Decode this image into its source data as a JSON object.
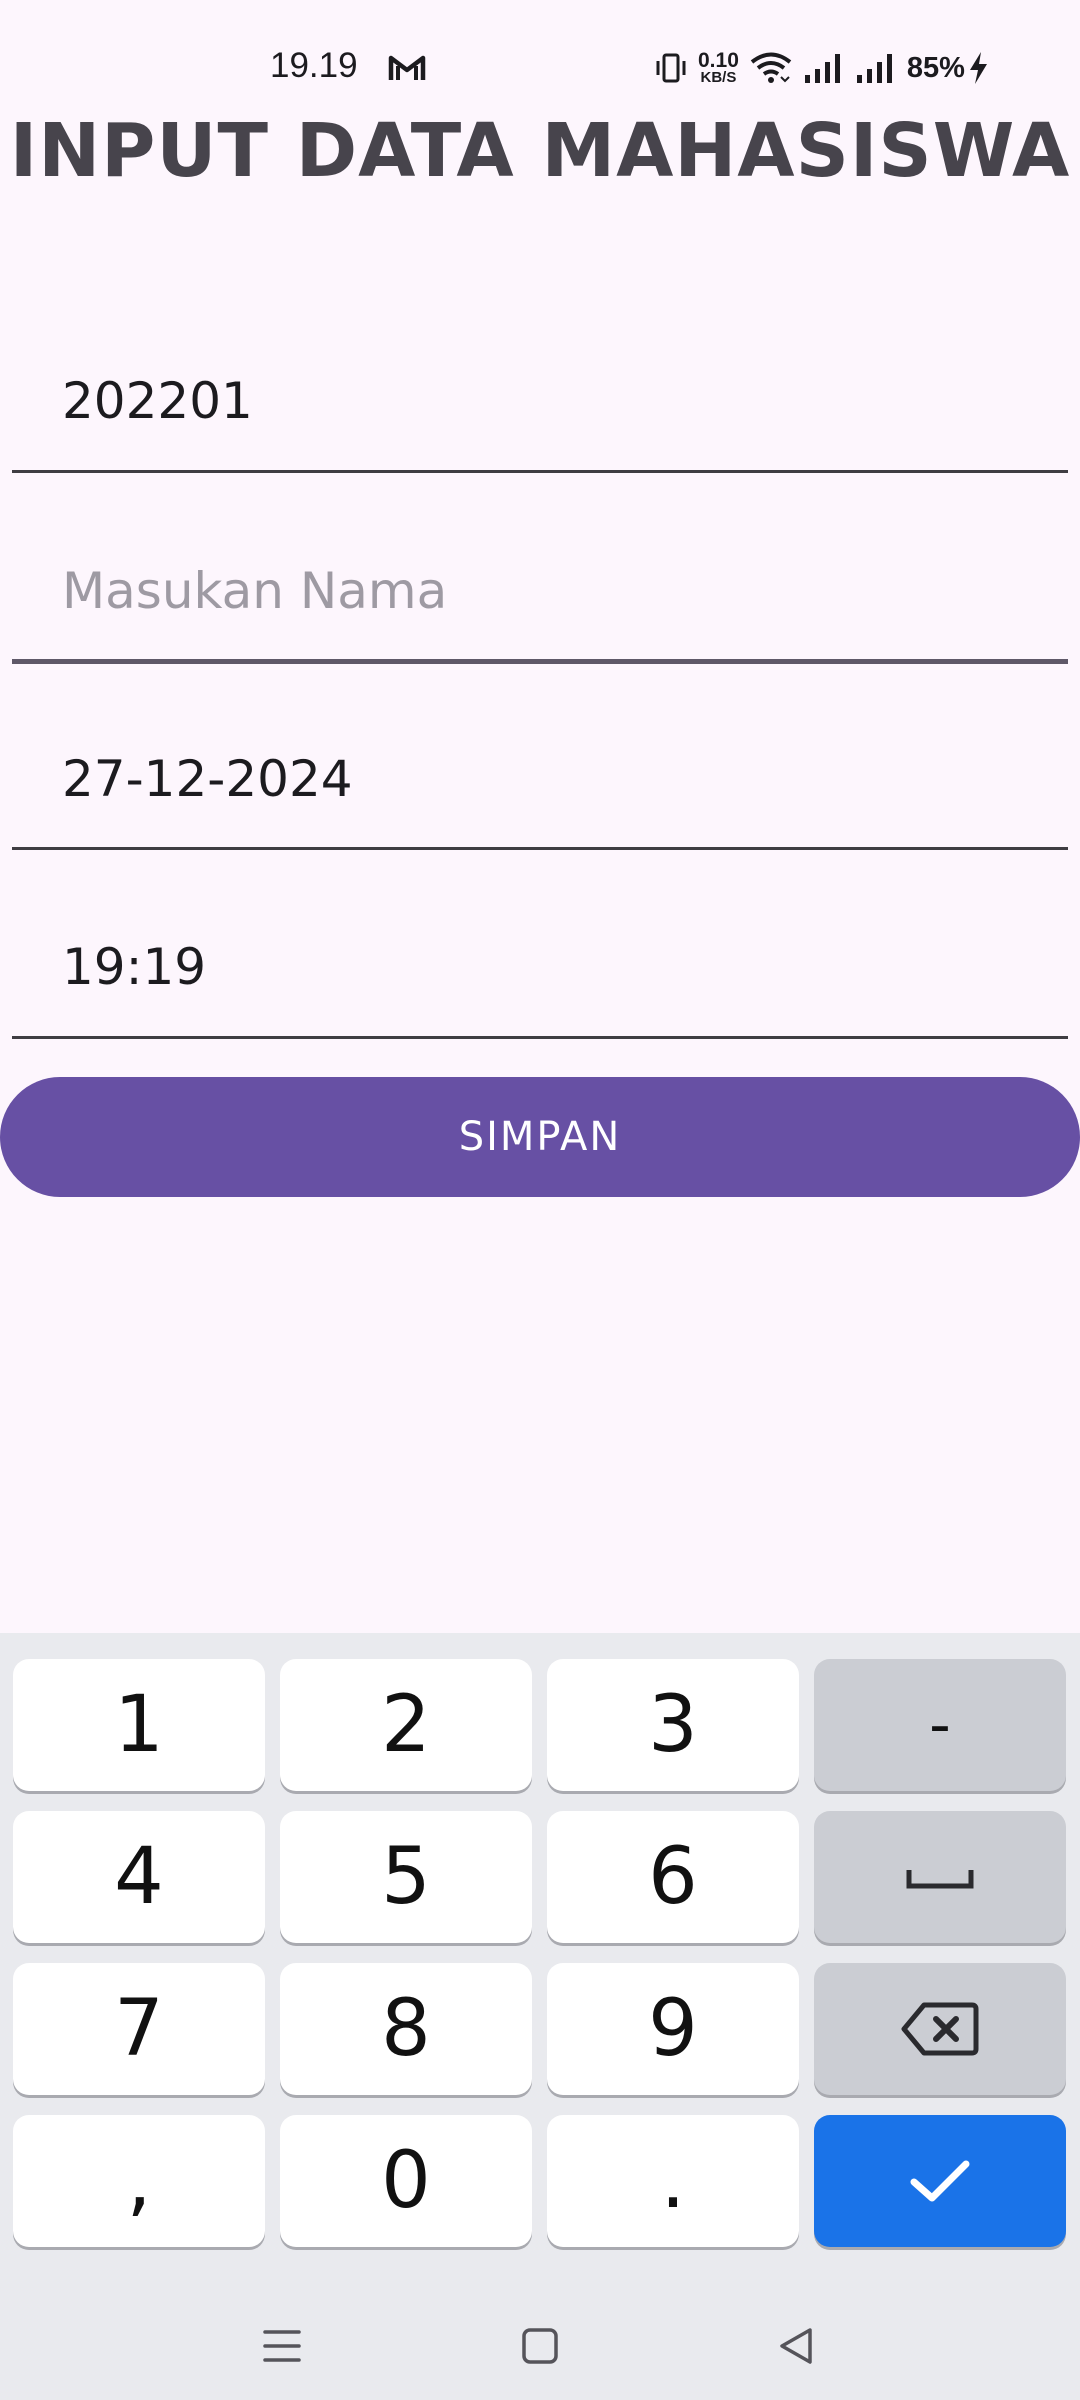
{
  "status_bar": {
    "time": "19.19",
    "net_speed_value": "0.10",
    "net_speed_unit": "KB/S",
    "battery": "85%"
  },
  "page": {
    "title": "INPUT DATA MAHASISWA"
  },
  "form": {
    "nim_value": "202201",
    "name_placeholder": "Masukan Nama",
    "date_value": "27-12-2024",
    "time_value": "19:19",
    "save_label": "SIMPAN"
  },
  "keyboard": {
    "keys": {
      "k1": "1",
      "k2": "2",
      "k3": "3",
      "minus": "-",
      "k4": "4",
      "k5": "5",
      "k6": "6",
      "k7": "7",
      "k8": "8",
      "k9": "9",
      "comma": ",",
      "k0": "0",
      "period": "."
    },
    "icons": [
      "space-icon",
      "backspace-icon",
      "checkmark-icon"
    ],
    "accent_color": "#1a73e8"
  },
  "colors": {
    "primary": "#6750a4",
    "background": "#fdf6fd"
  },
  "nav_bar": {
    "icons": [
      "menu-icon",
      "home-square-icon",
      "back-triangle-icon"
    ]
  }
}
